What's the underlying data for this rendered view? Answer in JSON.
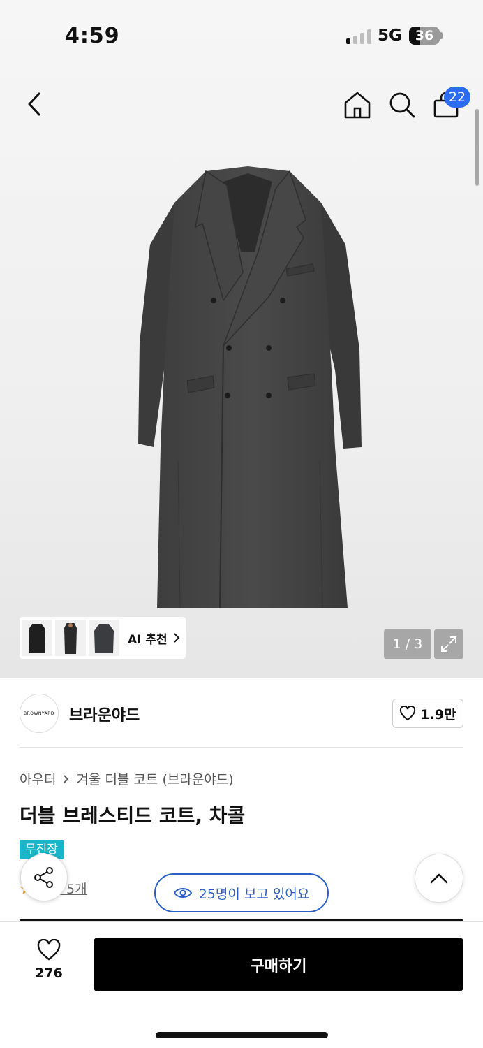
{
  "status_bar": {
    "time": "4:59",
    "network": "5G",
    "battery": "36",
    "battery_fraction": 0.36
  },
  "header": {
    "cart_count": "22"
  },
  "gallery": {
    "ai_label": "AI 추천",
    "counter": "1 / 3",
    "thumbnail_count": 3
  },
  "brand": {
    "logo_text": "BROWNYARD",
    "name": "브라운야드",
    "likes": "1.9만"
  },
  "product": {
    "breadcrumb": [
      "아우터",
      "겨울 더블 코트 (브라운야드)"
    ],
    "title": "더블 브레스티드 코트, 차콜",
    "badge": "무진장",
    "reviews": "후기 5개",
    "viewers": "25명이 보고 있어요"
  },
  "bottom_bar": {
    "wish_count": "276",
    "buy_label": "구매하기"
  },
  "colors": {
    "accent_blue": "#2b6cf0",
    "badge_teal": "#19b6c9",
    "viewer_blue": "#2b5fc7",
    "buy_black": "#000000"
  }
}
